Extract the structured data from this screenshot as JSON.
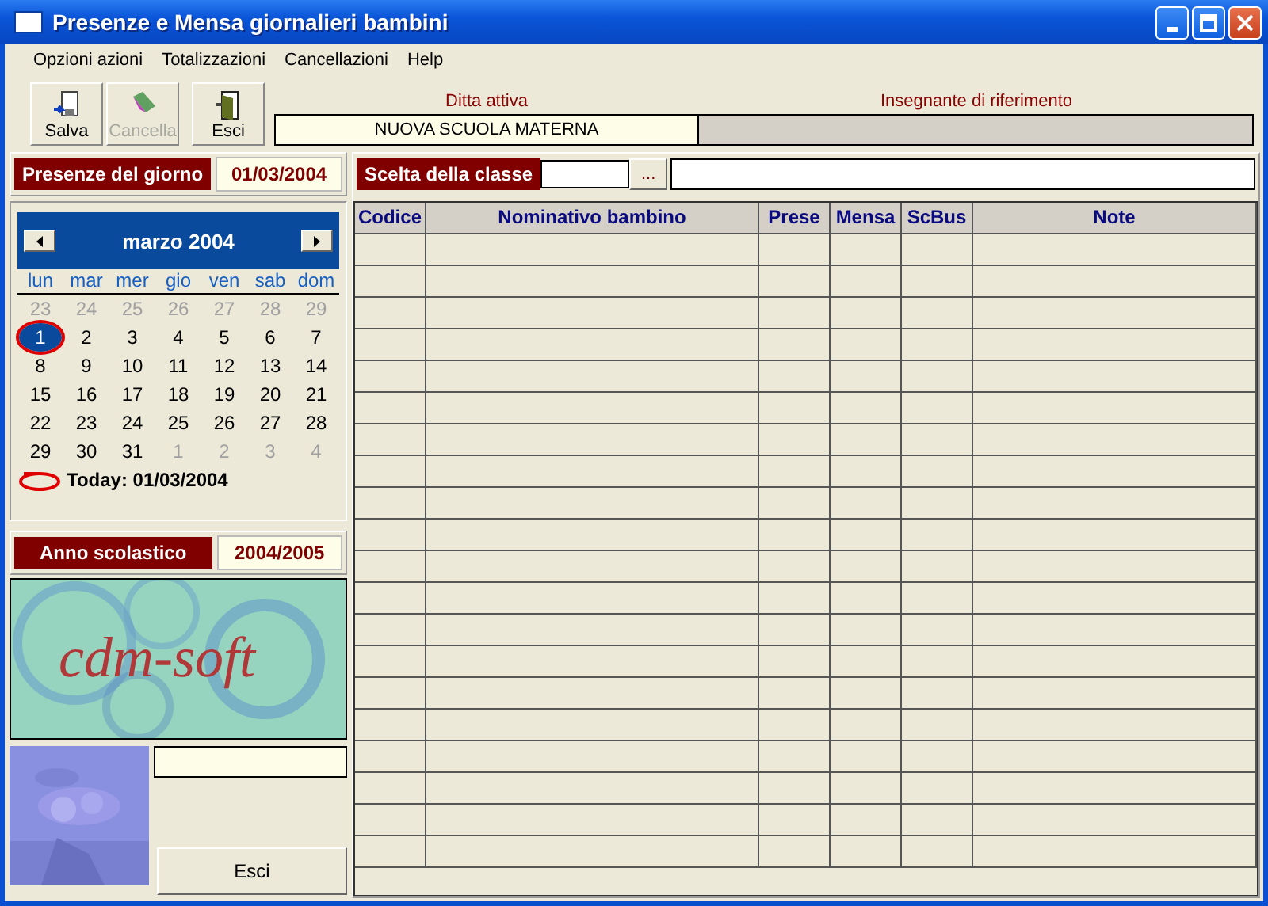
{
  "window": {
    "title": "Presenze e Mensa giornalieri bambini"
  },
  "menu": [
    {
      "label": "Opzioni azioni"
    },
    {
      "label": "Totalizzazioni"
    },
    {
      "label": "Cancellazioni"
    },
    {
      "label": "Help"
    }
  ],
  "toolbar": [
    {
      "label": "Salva",
      "kind": "save",
      "disabled": false
    },
    {
      "label": "Cancella",
      "kind": "delete",
      "disabled": true
    },
    {
      "label": "Esci",
      "kind": "exit",
      "disabled": false
    }
  ],
  "company": {
    "label": "Ditta attiva",
    "value": "NUOVA SCUOLA MATERNA"
  },
  "teacher": {
    "label": "Insegnante di riferimento"
  },
  "day": {
    "label": "Presenze del giorno",
    "value": "01/03/2004"
  },
  "calendar": {
    "month": "marzo 2004",
    "weekdays": [
      "lun",
      "mar",
      "mer",
      "gio",
      "ven",
      "sab",
      "dom"
    ],
    "days": [
      {
        "n": "23",
        "dimmed": true,
        "selected": false
      },
      {
        "n": "24",
        "dimmed": true,
        "selected": false
      },
      {
        "n": "25",
        "dimmed": true,
        "selected": false
      },
      {
        "n": "26",
        "dimmed": true,
        "selected": false
      },
      {
        "n": "27",
        "dimmed": true,
        "selected": false
      },
      {
        "n": "28",
        "dimmed": true,
        "selected": false
      },
      {
        "n": "29",
        "dimmed": true,
        "selected": false
      },
      {
        "n": "1",
        "dimmed": false,
        "selected": true
      },
      {
        "n": "2",
        "dimmed": false,
        "selected": false
      },
      {
        "n": "3",
        "dimmed": false,
        "selected": false
      },
      {
        "n": "4",
        "dimmed": false,
        "selected": false
      },
      {
        "n": "5",
        "dimmed": false,
        "selected": false
      },
      {
        "n": "6",
        "dimmed": false,
        "selected": false
      },
      {
        "n": "7",
        "dimmed": false,
        "selected": false
      },
      {
        "n": "8",
        "dimmed": false,
        "selected": false
      },
      {
        "n": "9",
        "dimmed": false,
        "selected": false
      },
      {
        "n": "10",
        "dimmed": false,
        "selected": false
      },
      {
        "n": "11",
        "dimmed": false,
        "selected": false
      },
      {
        "n": "12",
        "dimmed": false,
        "selected": false
      },
      {
        "n": "13",
        "dimmed": false,
        "selected": false
      },
      {
        "n": "14",
        "dimmed": false,
        "selected": false
      },
      {
        "n": "15",
        "dimmed": false,
        "selected": false
      },
      {
        "n": "16",
        "dimmed": false,
        "selected": false
      },
      {
        "n": "17",
        "dimmed": false,
        "selected": false
      },
      {
        "n": "18",
        "dimmed": false,
        "selected": false
      },
      {
        "n": "19",
        "dimmed": false,
        "selected": false
      },
      {
        "n": "20",
        "dimmed": false,
        "selected": false
      },
      {
        "n": "21",
        "dimmed": false,
        "selected": false
      },
      {
        "n": "22",
        "dimmed": false,
        "selected": false
      },
      {
        "n": "23",
        "dimmed": false,
        "selected": false
      },
      {
        "n": "24",
        "dimmed": false,
        "selected": false
      },
      {
        "n": "25",
        "dimmed": false,
        "selected": false
      },
      {
        "n": "26",
        "dimmed": false,
        "selected": false
      },
      {
        "n": "27",
        "dimmed": false,
        "selected": false
      },
      {
        "n": "28",
        "dimmed": false,
        "selected": false
      },
      {
        "n": "29",
        "dimmed": false,
        "selected": false
      },
      {
        "n": "30",
        "dimmed": false,
        "selected": false
      },
      {
        "n": "31",
        "dimmed": false,
        "selected": false
      },
      {
        "n": "1",
        "dimmed": true,
        "selected": false
      },
      {
        "n": "2",
        "dimmed": true,
        "selected": false
      },
      {
        "n": "3",
        "dimmed": true,
        "selected": false
      },
      {
        "n": "4",
        "dimmed": true,
        "selected": false
      }
    ],
    "today": "Today: 01/03/2004"
  },
  "school_year": {
    "label": "Anno scolastico",
    "value": "2004/2005"
  },
  "logo": {
    "text": "cdm-soft"
  },
  "exit_button": {
    "label": "Esci"
  },
  "class_select": {
    "label": "Scelta della classe",
    "browse": "..."
  },
  "table": {
    "columns": [
      "Codice",
      "Nominativo bambino",
      "Prese",
      "Mensa",
      "ScBus",
      "Note"
    ]
  }
}
